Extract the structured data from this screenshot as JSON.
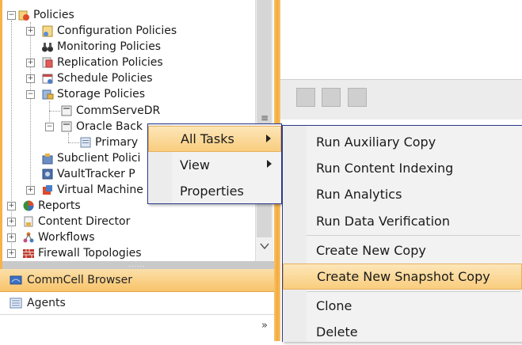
{
  "tree": {
    "policies": "Policies",
    "configuration_policies": "Configuration Policies",
    "monitoring_policies": "Monitoring Policies",
    "replication_policies": "Replication Policies",
    "schedule_policies": "Schedule Policies",
    "storage_policies": "Storage Policies",
    "commservedr": "CommServeDR",
    "oracle_backup": "Oracle Back",
    "primary": "Primary",
    "subclient_policies": "Subclient Polici",
    "vaulttracker": "VaultTracker P",
    "virtual_machine": "Virtual Machine",
    "reports": "Reports",
    "content_director": "Content Director",
    "workflows": "Workflows",
    "firewall_topologies": "Firewall Topologies"
  },
  "nav": {
    "commcell_browser": "CommCell Browser",
    "agents": "Agents",
    "overflow": "»"
  },
  "menu": {
    "all_tasks": "All Tasks",
    "view": "View",
    "properties": "Properties"
  },
  "submenu": {
    "items": [
      "Run Auxiliary Copy",
      "Run Content Indexing",
      "Run Analytics",
      "Run Data Verification",
      "Create New Copy",
      "Create New Snapshot Copy",
      "Clone",
      "Delete"
    ],
    "highlighted_index": 5
  },
  "colors": {
    "accent_orange": "#f7a93b",
    "menu_border": "#2b3a8c",
    "highlight": "#f9cd7e"
  }
}
